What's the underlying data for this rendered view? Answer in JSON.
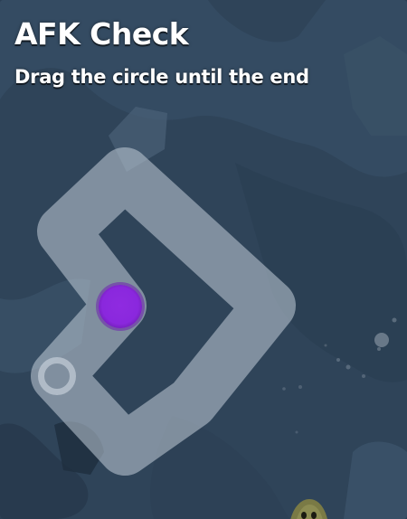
{
  "header": {
    "title": "AFK Check",
    "instruction": "Drag the circle until the end"
  },
  "game": {
    "drag_handle": "drag-circle",
    "end_marker": "end-ring",
    "path_color": "#c3cdd8",
    "handle_color": "#8a28dd",
    "background_color": "#2b3f55"
  }
}
